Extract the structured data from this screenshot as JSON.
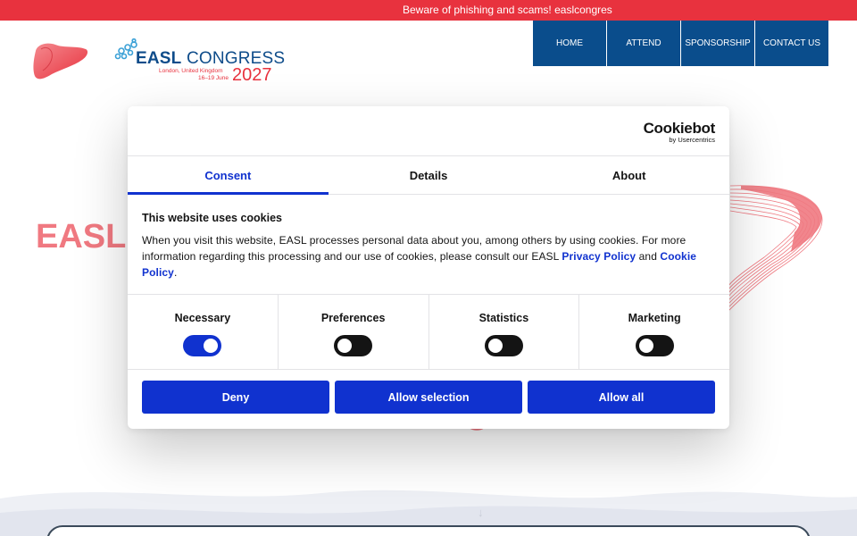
{
  "alert": {
    "text": "Beware of phishing and scams! easlcongres"
  },
  "header": {
    "logo": {
      "title_bold": "EASL",
      "title_rest": " CONGRESS",
      "location": "London, United Kingdom",
      "dates": "16–19 June",
      "year": "2027"
    },
    "nav": [
      {
        "label": "HOME"
      },
      {
        "label": "ATTEND"
      },
      {
        "label": "SPONSORSHIP"
      },
      {
        "label": "CONTACT US"
      }
    ]
  },
  "hero": {
    "title": "EASL"
  },
  "cookie_dialog": {
    "brand": "Cookiebot",
    "brand_sub": "by Usercentrics",
    "tabs": [
      {
        "label": "Consent",
        "active": true
      },
      {
        "label": "Details",
        "active": false
      },
      {
        "label": "About",
        "active": false
      }
    ],
    "heading": "This website uses cookies",
    "text_before": "When you visit this website, EASL processes personal data about you, among others by using cookies. For more information regarding this processing and our use of cookies, please consult our EASL ",
    "privacy_link": "Privacy Policy",
    "text_and": " and ",
    "cookie_link": "Cookie Policy",
    "text_end": ".",
    "categories": [
      {
        "label": "Necessary",
        "enabled": true
      },
      {
        "label": "Preferences",
        "enabled": false
      },
      {
        "label": "Statistics",
        "enabled": false
      },
      {
        "label": "Marketing",
        "enabled": false
      }
    ],
    "buttons": {
      "deny": "Deny",
      "allow_selection": "Allow selection",
      "allow_all": "Allow all"
    }
  },
  "colors": {
    "brand_red": "#e8323e",
    "brand_navy": "#0a4d8c",
    "cookiebot_blue": "#1032cf"
  }
}
